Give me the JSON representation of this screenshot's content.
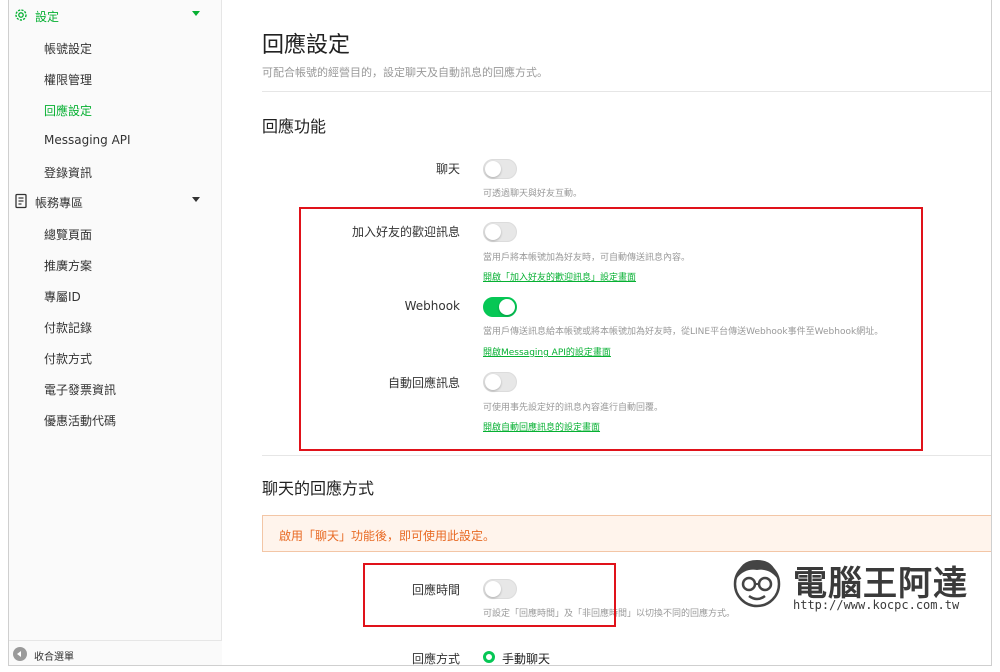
{
  "sidebar": {
    "settings_section": "設定",
    "settings_items": [
      "帳號設定",
      "權限管理",
      "回應設定",
      "Messaging API",
      "登錄資訊"
    ],
    "billing_section": "帳務專區",
    "billing_items": [
      "總覽頁面",
      "推廣方案",
      "專屬ID",
      "付款記錄",
      "付款方式",
      "電子發票資訊",
      "優惠活動代碼"
    ],
    "collapse_label": "收合選單"
  },
  "main": {
    "title": "回應設定",
    "description": "可配合帳號的經營目的，設定聊天及自動訊息的回應方式。",
    "features_title": "回應功能",
    "features": [
      {
        "label": "聊天",
        "enabled": false,
        "help": "可透過聊天與好友互動。",
        "link": ""
      },
      {
        "label": "加入好友的歡迎訊息",
        "enabled": false,
        "help": "當用戶將本帳號加為好友時，可自動傳送訊息內容。",
        "link": "開啟「加入好友的歡迎訊息」設定畫面"
      },
      {
        "label": "Webhook",
        "enabled": true,
        "help": "當用戶傳送訊息給本帳號或將本帳號加為好友時，從LINE平台傳送Webhook事件至Webhook網址。",
        "link": "開啟Messaging API的設定畫面"
      },
      {
        "label": "自動回應訊息",
        "enabled": false,
        "help": "可使用事先設定好的訊息內容進行自動回覆。",
        "link": "開啟自動回應訊息的設定畫面"
      }
    ],
    "chat_title": "聊天的回應方式",
    "chat_warning": "啟用「聊天」功能後，即可使用此設定。",
    "response_time": {
      "label": "回應時間",
      "enabled": false,
      "help": "可設定「回應時間」及「非回應時間」以切換不同的回應方式。"
    },
    "response_mode": {
      "label": "回應方式",
      "option": "手動聊天"
    }
  },
  "watermark": {
    "brand": "電腦王阿達",
    "url": "http://www.kocpc.com.tw"
  },
  "colors": {
    "accent": "#06c755",
    "link": "#06b032",
    "warning_text": "#e86a24",
    "highlight": "#e0121a"
  }
}
